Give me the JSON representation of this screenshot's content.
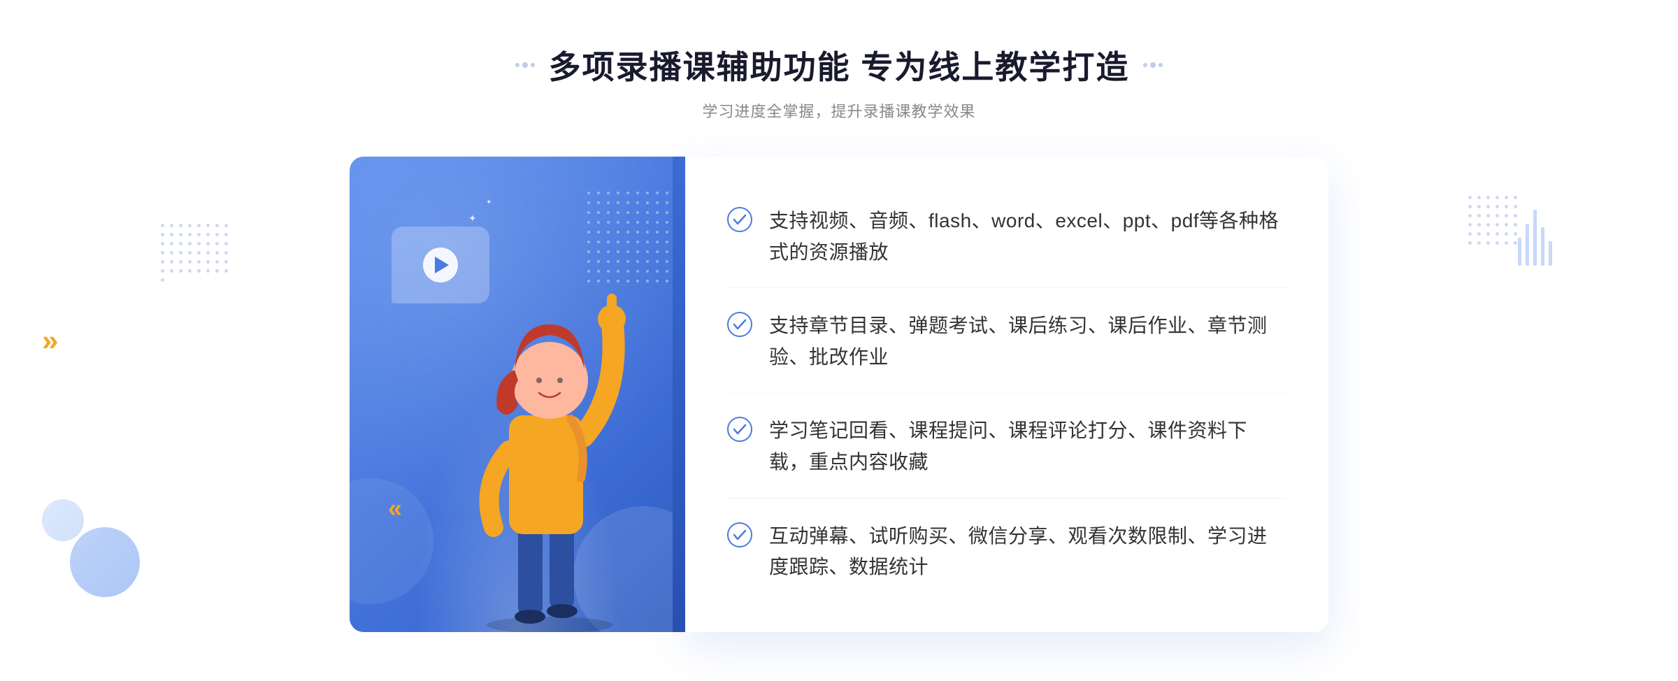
{
  "page": {
    "background": "#ffffff"
  },
  "header": {
    "title": "多项录播课辅助功能 专为线上教学打造",
    "subtitle": "学习进度全掌握，提升录播课教学效果"
  },
  "features": [
    {
      "id": 1,
      "text": "支持视频、音频、flash、word、excel、ppt、pdf等各种格式的资源播放"
    },
    {
      "id": 2,
      "text": "支持章节目录、弹题考试、课后练习、课后作业、章节测验、批改作业"
    },
    {
      "id": 3,
      "text": "学习笔记回看、课程提问、课程评论打分、课件资料下载，重点内容收藏"
    },
    {
      "id": 4,
      "text": "互动弹幕、试听购买、微信分享、观看次数限制、学习进度跟踪、数据统计"
    }
  ],
  "decorators": {
    "left_decorator": "❮❮",
    "sparkle1": "✦",
    "sparkle2": "✦"
  },
  "colors": {
    "accent_blue": "#4a7be0",
    "accent_orange": "#f5a623",
    "text_dark": "#1a1a2e",
    "text_gray": "#888888",
    "text_feature": "#333333"
  }
}
